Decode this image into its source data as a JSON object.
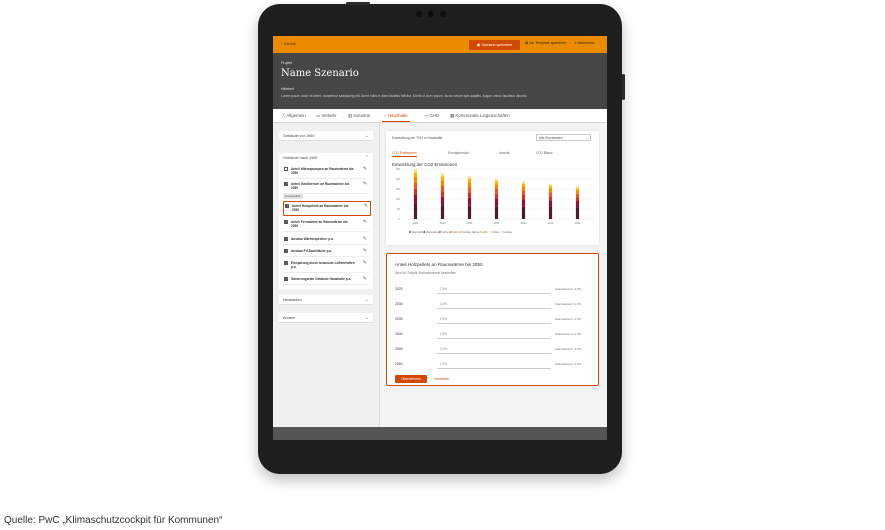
{
  "app": {
    "back_label": "Zurück",
    "save_label": "Szenario speichern",
    "template_label": "Als Template speichern",
    "cancel_label": "Abbrechen"
  },
  "header": {
    "overline": "Projekt",
    "title": "Name Szenario",
    "note_label": "Hilfetext",
    "note_text": "Lorem ipsum dolor sit amet, consetetur sadipscing elit. Amet nulla in diam facilisis efficitur. Morbi ut at ex ipsum, lacus rutrum quis sagittis. Augue varius faucibus lobortis."
  },
  "tabs": [
    {
      "label": "Allgemein",
      "icon": "info-icon"
    },
    {
      "label": "Verkehr",
      "icon": "car-icon"
    },
    {
      "label": "Industrie",
      "icon": "factory-icon"
    },
    {
      "label": "Haushalte",
      "icon": "house-icon"
    },
    {
      "label": "GHD",
      "icon": "link-icon"
    },
    {
      "label": "Kommunale Liegenschaften",
      "icon": "building-icon"
    }
  ],
  "sidebar": {
    "sections": [
      "Gebäude vor 1960",
      "Gebäude nach 1960",
      "Neubauten",
      "Andere"
    ],
    "items": [
      {
        "label": "Anteil Wärmepumpen an Raumwärme bis 2050",
        "checked": false
      },
      {
        "label": "Anteil Gasthermen an Raumwärme bis 2050",
        "checked": true
      },
      {
        "label": "Anteil Holzpellets an Raumwärme bis 2050",
        "checked": true
      },
      {
        "label": "Anteil Fernwärme an Raumwärme bis 2050",
        "checked": true
      },
      {
        "label": "Ausbau Wärmespeicher p.a.",
        "checked": true
      },
      {
        "label": "Ausbau PV-Dachfläche p.a.",
        "checked": true
      },
      {
        "label": "Einsparung durch bewusste Lüftverhalten p.a.",
        "checked": true
      },
      {
        "label": "Sanierungsrate Gebäude Haushalte p.a.",
        "checked": true
      }
    ],
    "pill_label": "Ausgewählt"
  },
  "chart_card": {
    "select_left": "Entwicklung der THG in Haushalte",
    "select_right": "Alle Einzeldaten",
    "tabs": [
      "CO2 Emissionen",
      "Energiebedarf",
      "Investit",
      "CO2 Bilanz"
    ],
    "title": "Entwicklung der CO2 Emissionen"
  },
  "chart_data": {
    "type": "bar",
    "stacked": true,
    "categories": [
      "2020",
      "2025",
      "2030",
      "2035",
      "2040",
      "2045",
      "2050"
    ],
    "ylim": [
      0,
      250
    ],
    "yticks": [
      "250",
      "200",
      "150",
      "100",
      "50",
      "0"
    ],
    "series": [
      {
        "name": "Raumwärme",
        "color": "#4a1c2e",
        "values": [
          75,
          68,
          66,
          64,
          62,
          60,
          58
        ]
      },
      {
        "name": "Warmwasser",
        "color": "#8a1538",
        "values": [
          45,
          42,
          40,
          38,
          36,
          34,
          32
        ]
      },
      {
        "name": "Kochen",
        "color": "#c0392b",
        "values": [
          30,
          28,
          26,
          24,
          22,
          20,
          18
        ]
      },
      {
        "name": "Strom",
        "color": "#e05a2a",
        "values": [
          30,
          28,
          26,
          24,
          22,
          20,
          18
        ]
      },
      {
        "name": "Sonstige Wärme",
        "color": "#eb8c00",
        "values": [
          30,
          28,
          26,
          24,
          22,
          20,
          18
        ]
      },
      {
        "name": "Licht",
        "color": "#f2b705",
        "values": [
          20,
          18,
          16,
          14,
          12,
          10,
          8
        ]
      },
      {
        "name": "Kühlen",
        "color": "#ffd166",
        "values": [
          10,
          10,
          8,
          8,
          7,
          6,
          6
        ]
      },
      {
        "name": "Sonstige",
        "color": "#ffe7a8",
        "values": [
          10,
          8,
          8,
          6,
          6,
          6,
          6
        ]
      }
    ]
  },
  "form": {
    "title": "Anteil Holzpellets an Raumwärme bis 2050",
    "subtitle": "Wert für Zieljahr Maßnahmenrat bearbeiten",
    "rows": [
      {
        "year": "2025",
        "value": "2,5%",
        "std": "Standardwert: 2,5%"
      },
      {
        "year": "2030",
        "value": "2,5%",
        "std": "Standardwert: 2,5%"
      },
      {
        "year": "2035",
        "value": "2,5%",
        "std": "Standardwert: 2,5%"
      },
      {
        "year": "2040",
        "value": "2,5%",
        "std": "Standardwert: 2,5%"
      },
      {
        "year": "2045",
        "value": "2,5%",
        "std": "Standardwert: 2,5%"
      },
      {
        "year": "2050",
        "value": "2,5%",
        "std": "Standardwert: 2,5%"
      }
    ],
    "apply_label": "Übernehmen",
    "discard_label": "Verwerfen"
  },
  "caption": "Quelle: PwC „Klimaschutzcockpit für Kommunen“"
}
